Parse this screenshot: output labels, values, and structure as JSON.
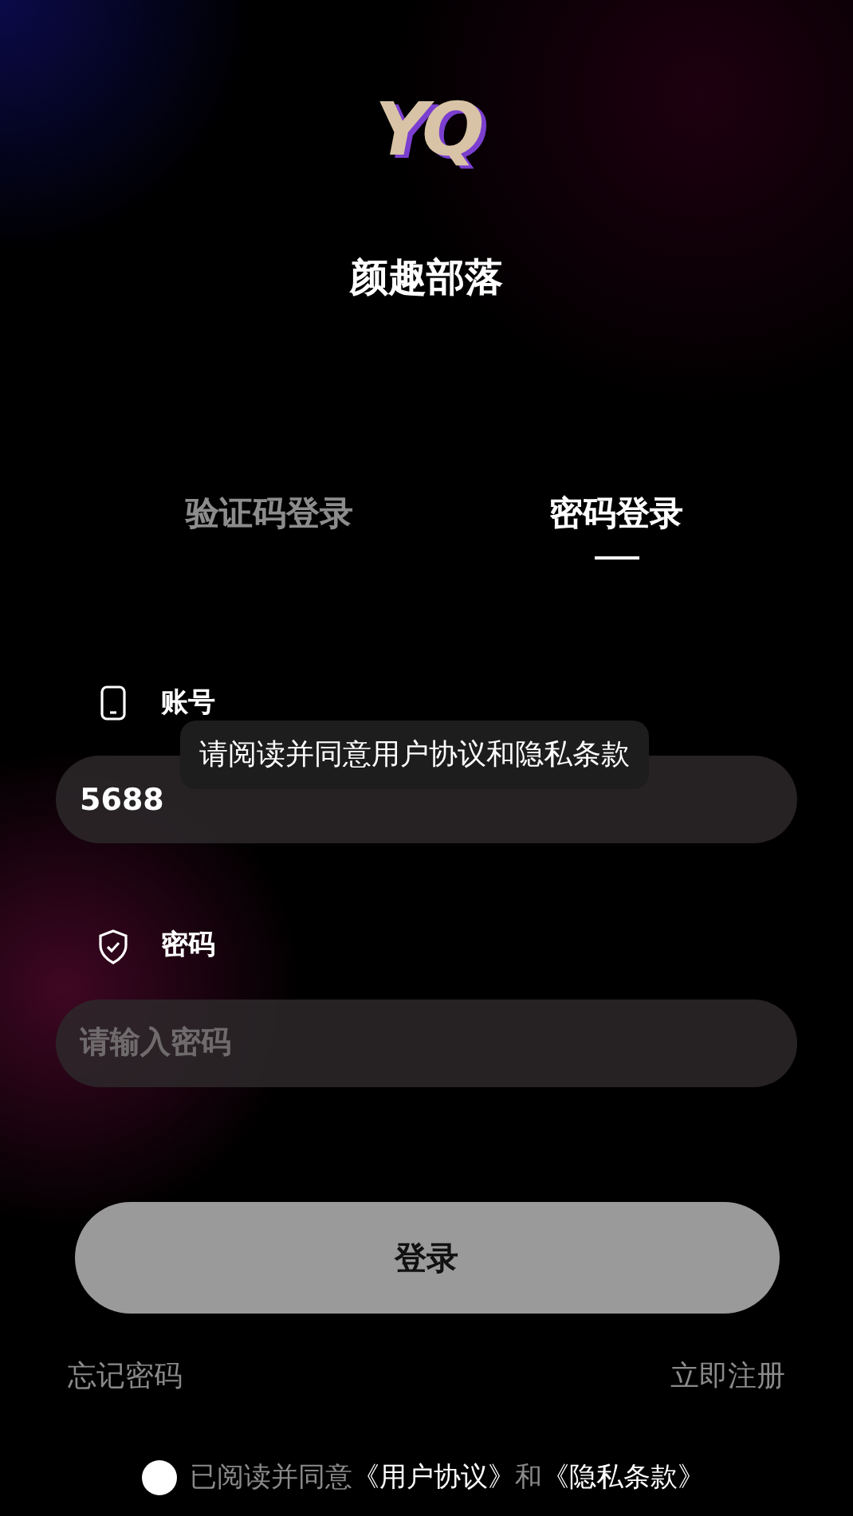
{
  "logo": {
    "text": "YQ"
  },
  "app_name": "颜趣部落",
  "tabs": [
    {
      "label": "验证码登录",
      "selected": false
    },
    {
      "label": "密码登录",
      "selected": true
    }
  ],
  "fields": [
    {
      "kind": "phone",
      "label": "账号",
      "value": "5688"
    },
    {
      "kind": "shield",
      "label": "密码",
      "placeholder": "请输入密码"
    }
  ],
  "toast": "请阅读并同意用户协议和隐私条款",
  "login_button": "登录",
  "links": {
    "forgot": "忘记密码",
    "register": "立即注册"
  },
  "agreement": {
    "checked": false,
    "text": "已阅读并同意",
    "link1": "《用户协议》",
    "and": "和",
    "link2": "《隐私条款》"
  }
}
